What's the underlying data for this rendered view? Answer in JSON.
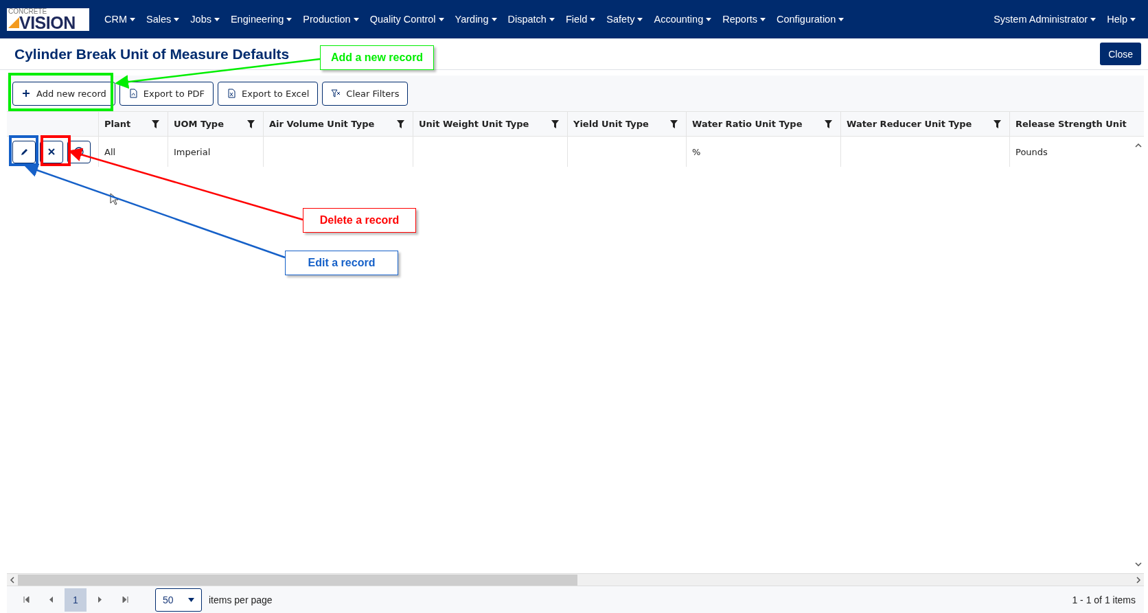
{
  "navbar": {
    "logo": {
      "top": "CONCRETE",
      "main": "VISION"
    },
    "menus": [
      "CRM",
      "Sales",
      "Jobs",
      "Engineering",
      "Production",
      "Quality Control",
      "Yarding",
      "Dispatch",
      "Field",
      "Safety",
      "Accounting",
      "Reports",
      "Configuration"
    ],
    "user_menus": [
      "System Administrator",
      "Help"
    ]
  },
  "page": {
    "title": "Cylinder Break Unit of Measure Defaults",
    "close_button": "Close"
  },
  "toolbar": [
    {
      "kind": "add",
      "label": "Add new record"
    },
    {
      "kind": "pdf",
      "label": "Export to PDF"
    },
    {
      "kind": "excel",
      "label": "Export to Excel"
    },
    {
      "kind": "filter",
      "label": "Clear Filters"
    }
  ],
  "table": {
    "columns": [
      "Plant",
      "UOM Type",
      "Air Volume Unit Type",
      "Unit Weight Unit Type",
      "Yield Unit Type",
      "Water Ratio Unit Type",
      "Water Reducer Unit Type",
      "Release Strength Unit"
    ],
    "rows": [
      {
        "actions": [
          {
            "kind": "edit"
          },
          {
            "kind": "delete"
          },
          {
            "kind": "info"
          }
        ],
        "cells": [
          "All",
          "Imperial",
          "",
          "",
          "",
          "%",
          "",
          "Pounds"
        ]
      }
    ]
  },
  "pager": {
    "pages": [
      {
        "label": "1",
        "selected": true
      }
    ],
    "page_size": "50",
    "page_size_label": "items per page",
    "summary": "1 - 1 of 1 items"
  },
  "annotations": [
    {
      "kind": "add",
      "text": "Add a new record",
      "color": "#00ee00"
    },
    {
      "kind": "delete",
      "text": "Delete a record",
      "color": "#ff0000"
    },
    {
      "kind": "edit",
      "text": "Edit a record",
      "color": "#1560c8"
    }
  ]
}
